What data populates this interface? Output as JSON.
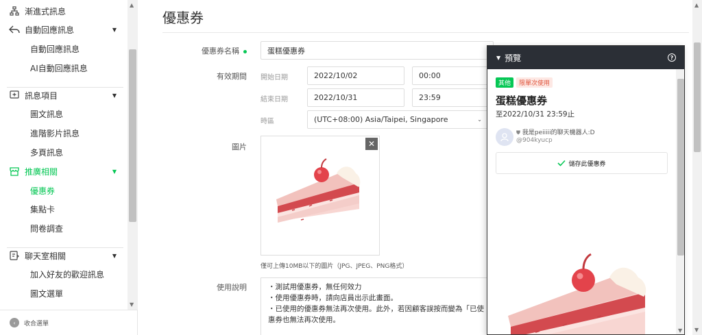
{
  "sidebar": {
    "items": [
      {
        "type": "sub-plain",
        "label": "漸進式訊息",
        "icon": "sitemap-icon"
      },
      {
        "type": "section",
        "label": "自動回應訊息",
        "icon": "reply-icon"
      },
      {
        "type": "sub",
        "label": "自動回應訊息"
      },
      {
        "type": "sub",
        "label": "AI自動回應訊息"
      },
      {
        "type": "section",
        "label": "訊息項目",
        "icon": "message-plus-icon"
      },
      {
        "type": "sub",
        "label": "圖文訊息"
      },
      {
        "type": "sub",
        "label": "進階影片訊息"
      },
      {
        "type": "sub",
        "label": "多頁訊息"
      },
      {
        "type": "section",
        "label": "推廣相關",
        "icon": "storefront-icon",
        "active": true
      },
      {
        "type": "sub",
        "label": "優惠券",
        "active": true
      },
      {
        "type": "sub",
        "label": "集點卡"
      },
      {
        "type": "sub",
        "label": "問卷調查"
      },
      {
        "type": "section",
        "label": "聊天室相關",
        "icon": "chat-room-icon"
      },
      {
        "type": "sub",
        "label": "加入好友的歡迎訊息"
      },
      {
        "type": "sub",
        "label": "圖文選單"
      }
    ],
    "collapse_label": "收合選單"
  },
  "main": {
    "title": "優惠券",
    "coupon_name_label": "優惠券名稱",
    "coupon_name_value": "蛋糕優惠券",
    "validity_label": "有效期間",
    "start_date_label": "開始日期",
    "start_date_value": "2022/10/02",
    "start_time_value": "00:00",
    "end_date_label": "結束日期",
    "end_date_value": "2022/10/31",
    "end_time_value": "23:59",
    "timezone_label": "時區",
    "timezone_value": "(UTC+08:00) Asia/Taipei, Singapore",
    "image_label": "圖片",
    "image_hint": "僅可上傳10MB以下的圖片（JPG、JPEG、PNG格式）",
    "usage_label": "使用說明",
    "usage_lines": [
      "・測試用優惠券，無任何效力",
      "・使用優惠券時，請向店員出示此畫面。",
      "・已使用的優惠券無法再次使用。此外，若因顧客誤按而變為「已使",
      "惠券也無法再次使用。"
    ]
  },
  "preview": {
    "title": "預覽",
    "help_icon": "?",
    "tag_category": "其他",
    "tag_usage": "限單次使用",
    "coupon_name": "蛋糕優惠券",
    "expiry": "至2022/10/31 23:59止",
    "account_name": "我是peiiiii的聊天機器人:D",
    "account_id": "@904kyucp",
    "save_label": "儲存此優惠券"
  },
  "colors": {
    "accent": "#06c755",
    "preview_header": "#2b2f36",
    "tag_red_text": "#e0553c"
  }
}
